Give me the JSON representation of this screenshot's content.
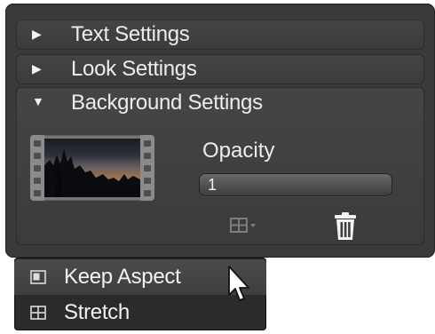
{
  "panel": {
    "sections": [
      {
        "label": "Text Settings",
        "arrow": "▶"
      },
      {
        "label": "Look Settings",
        "arrow": "▶"
      },
      {
        "label": "Background Settings",
        "arrow": "▼"
      }
    ],
    "background": {
      "opacity_label": "Opacity",
      "opacity_value": "1",
      "layout_icon": "layout-grid-dropdown-icon",
      "trash_icon": "trash-icon"
    }
  },
  "menu": {
    "items": [
      {
        "label": "Keep Aspect",
        "icon": "keep-aspect-icon",
        "highlighted": true
      },
      {
        "label": "Stretch",
        "icon": "stretch-icon",
        "highlighted": false
      }
    ]
  }
}
